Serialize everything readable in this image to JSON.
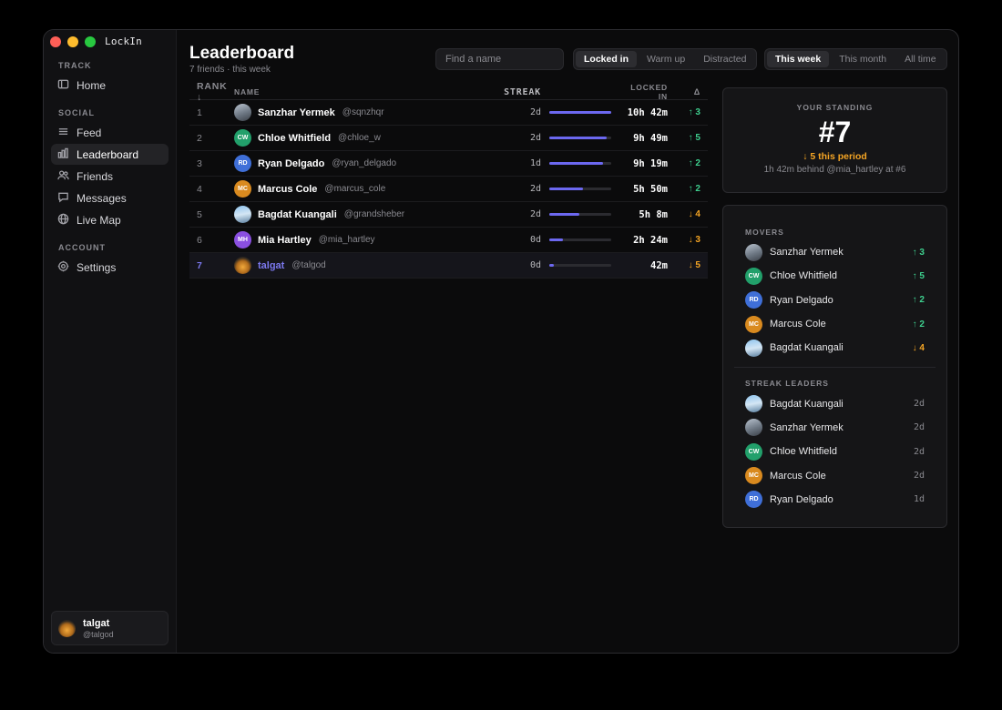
{
  "app": {
    "title": "LockIn"
  },
  "sidebar": {
    "sections": [
      {
        "label": "TRACK",
        "items": [
          {
            "label": "Home",
            "icon": "home-icon"
          }
        ]
      },
      {
        "label": "SOCIAL",
        "items": [
          {
            "label": "Feed",
            "icon": "feed-icon"
          },
          {
            "label": "Leaderboard",
            "icon": "chart-icon",
            "active": true
          },
          {
            "label": "Friends",
            "icon": "users-icon"
          },
          {
            "label": "Messages",
            "icon": "message-icon"
          },
          {
            "label": "Live Map",
            "icon": "globe-icon"
          }
        ]
      },
      {
        "label": "ACCOUNT",
        "items": [
          {
            "label": "Settings",
            "icon": "gear-icon"
          }
        ]
      }
    ],
    "user": {
      "name": "talgat",
      "handle": "@talgod"
    }
  },
  "header": {
    "title": "Leaderboard",
    "subtitle": "7 friends · this week",
    "search_placeholder": "Find a name",
    "mode_options": [
      "Locked in",
      "Warm up",
      "Distracted"
    ],
    "mode_selected": "Locked in",
    "period_options": [
      "This week",
      "This month",
      "All time"
    ],
    "period_selected": "This week"
  },
  "table": {
    "columns": {
      "rank": "RANK ↓",
      "name": "NAME",
      "streak": "STREAK",
      "locked": "LOCKED IN",
      "delta": "Δ"
    },
    "rows": [
      {
        "rank": "1",
        "name": "Sanzhar Yermek",
        "handle": "@sqnzhqr",
        "avatar": "photo1",
        "initials": "",
        "streak": "2d",
        "progress": 1.0,
        "locked": "10h 42m",
        "delta": "↑ 3",
        "dir": "up"
      },
      {
        "rank": "2",
        "name": "Chloe Whitfield",
        "handle": "@chloe_w",
        "avatar": "#22a06b",
        "initials": "CW",
        "streak": "2d",
        "progress": 0.92,
        "locked": "9h 49m",
        "delta": "↑ 5",
        "dir": "up"
      },
      {
        "rank": "3",
        "name": "Ryan Delgado",
        "handle": "@ryan_delgado",
        "avatar": "#3f6fd8",
        "initials": "RD",
        "streak": "1d",
        "progress": 0.87,
        "locked": "9h 19m",
        "delta": "↑ 2",
        "dir": "up"
      },
      {
        "rank": "4",
        "name": "Marcus Cole",
        "handle": "@marcus_cole",
        "avatar": "#d98a1f",
        "initials": "MC",
        "streak": "2d",
        "progress": 0.55,
        "locked": "5h 50m",
        "delta": "↑ 2",
        "dir": "up"
      },
      {
        "rank": "5",
        "name": "Bagdat Kuangali",
        "handle": "@grandsheber",
        "avatar": "photo2",
        "initials": "",
        "streak": "2d",
        "progress": 0.48,
        "locked": "5h 8m",
        "delta": "↓ 4",
        "dir": "down"
      },
      {
        "rank": "6",
        "name": "Mia Hartley",
        "handle": "@mia_hartley",
        "avatar": "#8a4fe0",
        "initials": "MH",
        "streak": "0d",
        "progress": 0.22,
        "locked": "2h 24m",
        "delta": "↓ 3",
        "dir": "down"
      },
      {
        "rank": "7",
        "name": "talgat",
        "handle": "@talgod",
        "avatar": "photo3",
        "initials": "",
        "streak": "0d",
        "progress": 0.07,
        "locked": "42m",
        "delta": "↓ 5",
        "dir": "down",
        "me": true
      }
    ]
  },
  "standing": {
    "label": "YOUR STANDING",
    "rank": "#7",
    "change": "↓ 5 this period",
    "behind": "1h 42m behind @mia_hartley at #6"
  },
  "movers": {
    "label": "MOVERS",
    "items": [
      {
        "name": "Sanzhar Yermek",
        "avatar": "photo1",
        "initials": "",
        "value": "↑ 3",
        "dir": "up"
      },
      {
        "name": "Chloe Whitfield",
        "avatar": "#22a06b",
        "initials": "CW",
        "value": "↑ 5",
        "dir": "up"
      },
      {
        "name": "Ryan Delgado",
        "avatar": "#3f6fd8",
        "initials": "RD",
        "value": "↑ 2",
        "dir": "up"
      },
      {
        "name": "Marcus Cole",
        "avatar": "#d98a1f",
        "initials": "MC",
        "value": "↑ 2",
        "dir": "up"
      },
      {
        "name": "Bagdat Kuangali",
        "avatar": "photo2",
        "initials": "",
        "value": "↓ 4",
        "dir": "down"
      }
    ]
  },
  "streak_leaders": {
    "label": "STREAK LEADERS",
    "items": [
      {
        "name": "Bagdat Kuangali",
        "avatar": "photo2",
        "initials": "",
        "value": "2d"
      },
      {
        "name": "Sanzhar Yermek",
        "avatar": "photo1",
        "initials": "",
        "value": "2d"
      },
      {
        "name": "Chloe Whitfield",
        "avatar": "#22a06b",
        "initials": "CW",
        "value": "2d"
      },
      {
        "name": "Marcus Cole",
        "avatar": "#d98a1f",
        "initials": "MC",
        "value": "2d"
      },
      {
        "name": "Ryan Delgado",
        "avatar": "#3f6fd8",
        "initials": "RD",
        "value": "1d"
      }
    ]
  },
  "colors": {
    "accent": "#6c68f0",
    "up": "#3ecf8e",
    "down": "#f5a524"
  }
}
